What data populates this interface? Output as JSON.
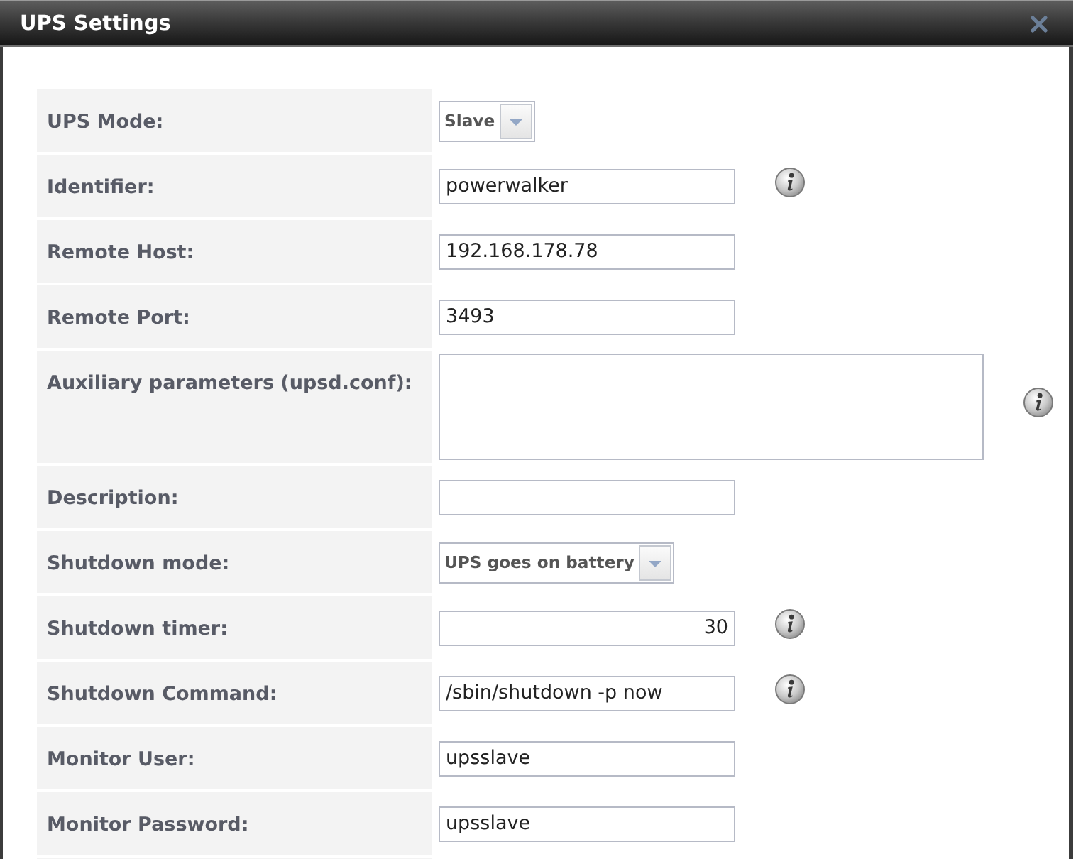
{
  "window": {
    "title": "UPS Settings"
  },
  "fields": [
    {
      "label": "UPS Mode:",
      "kind": "select",
      "value": "Slave",
      "info": false
    },
    {
      "label": "Identifier:",
      "kind": "text",
      "value": "powerwalker",
      "info": true
    },
    {
      "label": "Remote Host:",
      "kind": "text",
      "value": "192.168.178.78",
      "info": false
    },
    {
      "label": "Remote Port:",
      "kind": "text",
      "value": "3493",
      "info": false
    },
    {
      "label": "Auxiliary parameters (upsd.conf):",
      "kind": "textarea",
      "info": true
    },
    {
      "label": "Description:",
      "kind": "text",
      "info": false
    },
    {
      "label": "Shutdown mode:",
      "kind": "select",
      "value": "UPS goes on battery",
      "info": false
    },
    {
      "label": "Shutdown timer:",
      "kind": "number",
      "value": "30",
      "info": true
    },
    {
      "label": "Shutdown Command:",
      "kind": "text",
      "value": "/sbin/shutdown -p now",
      "info": true
    },
    {
      "label": "Monitor User:",
      "kind": "text",
      "value": "upsslave",
      "info": false
    },
    {
      "label": "Monitor Password:",
      "kind": "text",
      "value": "upsslave",
      "info": false
    }
  ]
}
